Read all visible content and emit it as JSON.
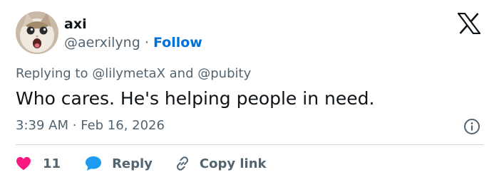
{
  "user": {
    "display_name": "axi",
    "handle": "@aerxilyng",
    "separator": "·",
    "follow_label": "Follow"
  },
  "reply_context": {
    "prefix": "Replying to",
    "mention1": "@lilymetaX",
    "joiner": "and",
    "mention2": "@pubity"
  },
  "tweet": {
    "text": "Who cares. He's helping people in need.",
    "time": "3:39 AM",
    "separator": "·",
    "date": "Feb 16, 2026"
  },
  "actions": {
    "like_count": "11",
    "reply_label": "Reply",
    "copy_label": "Copy link"
  },
  "icons": {
    "logo": "x-logo",
    "info": "info-icon",
    "like": "heart-icon",
    "reply": "speech-bubble-icon",
    "copy": "link-icon"
  },
  "colors": {
    "text": "#0f1419",
    "muted": "#536471",
    "link": "#006fd6",
    "heart": "#f91880",
    "reply_bubble": "#1d9bf0"
  }
}
